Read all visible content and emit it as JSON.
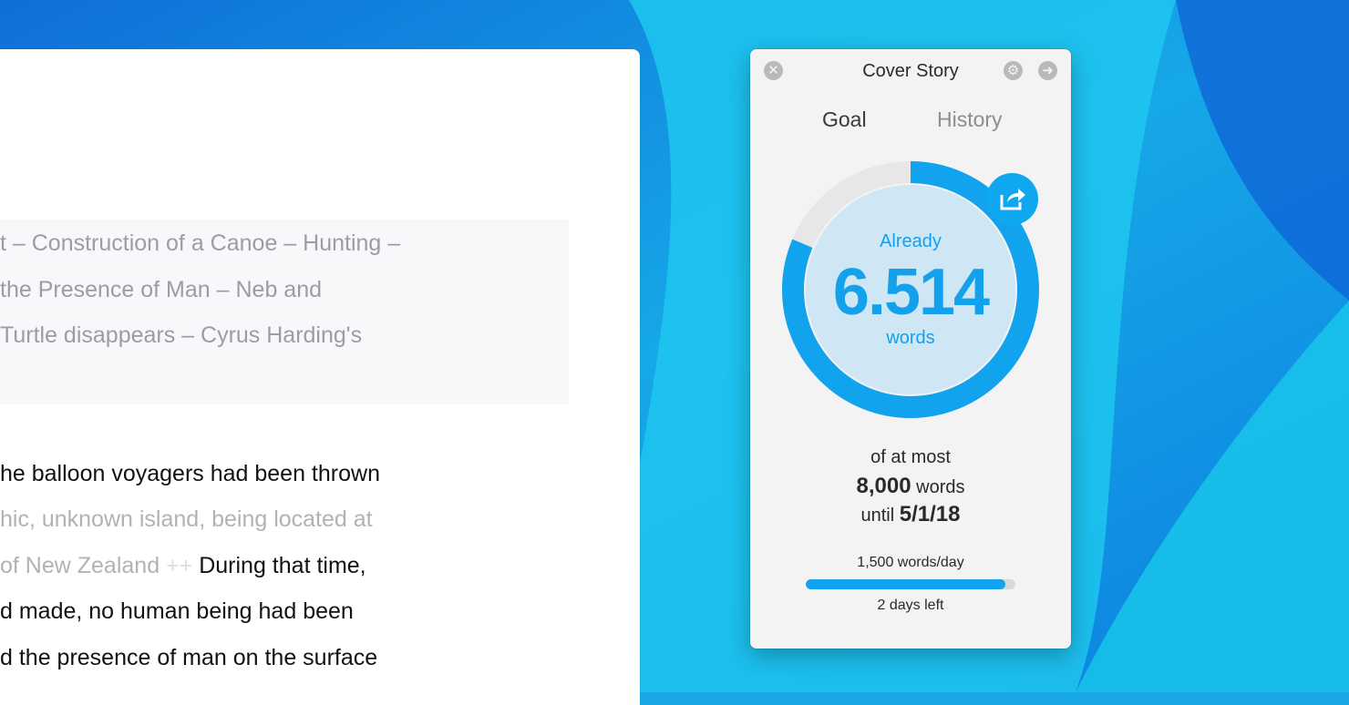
{
  "editor": {
    "quote_lines": [
      "t – Construction of a Canoe – Hunting –",
      "the Presence of Man – Neb and",
      "Turtle disappears – Cyrus Harding's"
    ],
    "body_line1": "he balloon voyagers had been thrown",
    "body_line2": "hic, unknown island, being located at",
    "body_line3_muted": "of New Zealand",
    "body_line3_mark": "++",
    "body_line3_text": "During that time,",
    "body_line4": "d made, no human being had been",
    "body_line5": "d the presence of man on the surface"
  },
  "widget": {
    "title": "Cover Story",
    "close_icon": "close-icon",
    "settings_icon": "gear-icon",
    "forward_icon": "arrow-right-icon",
    "tabs": [
      {
        "label": "Goal",
        "active": true
      },
      {
        "label": "History",
        "active": false
      }
    ],
    "already_label": "Already",
    "count": "6.514",
    "count_unit": "words",
    "share_icon": "share-icon",
    "ring_progress": 0.814,
    "of_at_most": "of at most",
    "goal_value": "8,000",
    "goal_unit": "words",
    "until_label": "until",
    "until_date": "5/1/18",
    "rate_text": "1,500 words/day",
    "days_progress": 0.95,
    "days_left": "2 days left",
    "accent_color": "#12a3ee"
  }
}
